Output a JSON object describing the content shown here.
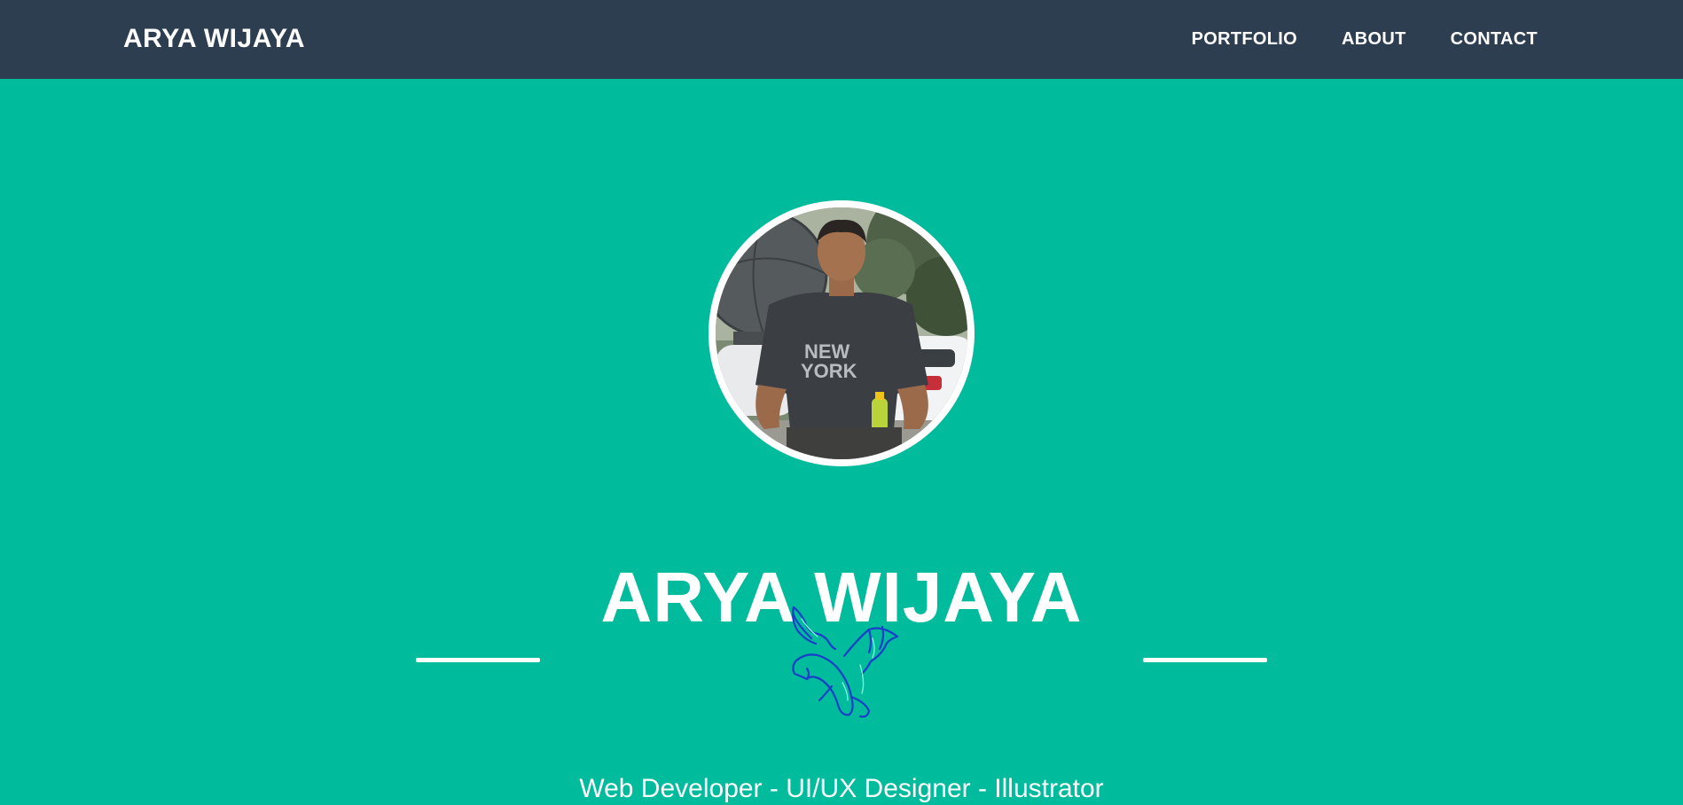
{
  "nav": {
    "brand": "ARYA WIJAYA",
    "links": [
      {
        "label": "PORTFOLIO"
      },
      {
        "label": "ABOUT"
      },
      {
        "label": "CONTACT"
      }
    ]
  },
  "hero": {
    "title": "ARYA WIJAYA",
    "subtitle": "Web Developer - UI/UX Designer - Illustrator",
    "avatar_icon": "profile-photo",
    "divider_icon": "dragon-icon"
  },
  "colors": {
    "navbar": "#2c3e50",
    "hero_bg": "#00bb9c",
    "text": "#ffffff"
  }
}
